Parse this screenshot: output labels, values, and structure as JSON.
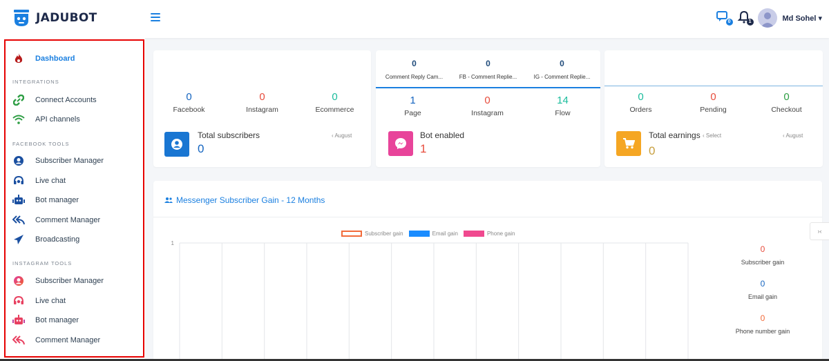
{
  "brand": {
    "name": "JADUBOT"
  },
  "user": {
    "name": "Md Sohel",
    "caret": "▾"
  },
  "header_icons": {
    "messages_badge": "0",
    "notifications_badge": "1"
  },
  "sidebar": {
    "dashboard": "Dashboard",
    "sections": {
      "integrations": "INTEGRATIONS",
      "facebook": "FACEBOOK TOOLS",
      "instagram": "INSTAGRAM TOOLS"
    },
    "integrations": [
      {
        "label": "Connect Accounts",
        "icon": "link-icon"
      },
      {
        "label": "API channels",
        "icon": "wifi-icon"
      }
    ],
    "facebook_tools": [
      {
        "label": "Subscriber Manager",
        "icon": "user-circle-icon"
      },
      {
        "label": "Live chat",
        "icon": "headset-icon"
      },
      {
        "label": "Bot manager",
        "icon": "robot-icon"
      },
      {
        "label": "Comment Manager",
        "icon": "reply-all-icon"
      },
      {
        "label": "Broadcasting",
        "icon": "paper-plane-icon"
      }
    ],
    "instagram_tools": [
      {
        "label": "Subscriber Manager",
        "icon": "user-circle-icon"
      },
      {
        "label": "Live chat",
        "icon": "headset-icon"
      },
      {
        "label": "Bot manager",
        "icon": "robot-icon"
      },
      {
        "label": "Comment Manager",
        "icon": "reply-all-icon"
      }
    ]
  },
  "card1": {
    "stats": [
      {
        "value": "0",
        "label": "Facebook"
      },
      {
        "value": "0",
        "label": "Instagram"
      },
      {
        "value": "0",
        "label": "Ecommerce"
      }
    ],
    "box_title": "Total subscribers",
    "box_value": "0",
    "period": "‹ August"
  },
  "card2": {
    "top": [
      {
        "value": "0",
        "label": "Comment Reply Cam..."
      },
      {
        "value": "0",
        "label": "FB - Comment Replie..."
      },
      {
        "value": "0",
        "label": "IG - Comment Replie..."
      }
    ],
    "stats": [
      {
        "value": "1",
        "label": "Page"
      },
      {
        "value": "0",
        "label": "Instagram"
      },
      {
        "value": "14",
        "label": "Flow"
      }
    ],
    "box_title": "Bot enabled",
    "box_value": "1"
  },
  "card3": {
    "stats": [
      {
        "value": "0",
        "label": "Orders"
      },
      {
        "value": "0",
        "label": "Pending"
      },
      {
        "value": "0",
        "label": "Checkout"
      }
    ],
    "box_title": "Total earnings",
    "select_label": "‹ Select",
    "box_value": "0",
    "period": "‹ August"
  },
  "chart_section": {
    "title": "Messenger Subscriber Gain - 12 Months",
    "side_stats": [
      {
        "value": "0",
        "label": "Subscriber gain"
      },
      {
        "value": "0",
        "label": "Email gain"
      },
      {
        "value": "0",
        "label": "Phone number gain"
      }
    ]
  },
  "chart_data": {
    "type": "line",
    "title": "",
    "series": [
      {
        "name": "Subscriber gain",
        "color": "#f26b3a",
        "values": []
      },
      {
        "name": "Email gain",
        "color": "#1a8cff",
        "values": []
      },
      {
        "name": "Phone gain",
        "color": "#f0498f",
        "values": []
      }
    ],
    "y_tick_labels": [
      "1"
    ],
    "ylim": [
      0,
      1
    ],
    "grid": true
  },
  "float_button": "›‹",
  "colors": {
    "accent": "#1a7fe0",
    "sub_box": "#1976d2",
    "bot_box": "#e8449a",
    "earn_box": "#f5a623",
    "highlight": "#e60000"
  }
}
